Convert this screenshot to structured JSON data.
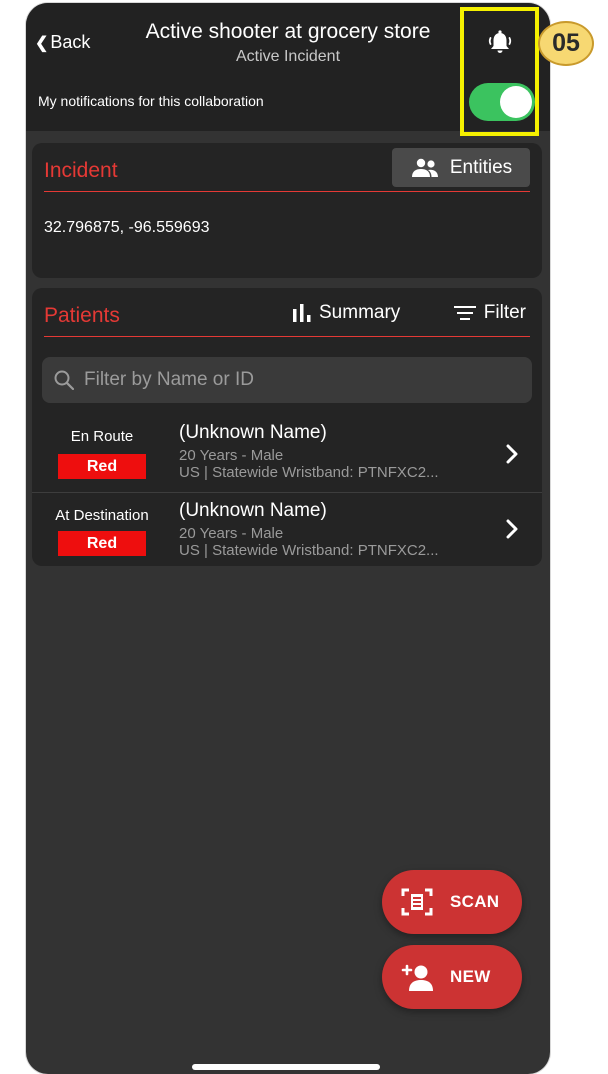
{
  "header": {
    "back_label": "Back",
    "title": "Active shooter at grocery store",
    "subtitle": "Active Incident",
    "notifications_label": "My notifications for this collaboration",
    "notifications_enabled": true,
    "bell_icon": "bell-ringing-icon"
  },
  "callout": {
    "step": "05",
    "color": "#f5f000"
  },
  "incident": {
    "title": "Incident",
    "entities_label": "Entities",
    "coordinates": "32.796875, -96.559693"
  },
  "patients": {
    "title": "Patients",
    "summary_label": "Summary",
    "filter_label": "Filter",
    "search_placeholder": "Filter by Name or ID",
    "rows": [
      {
        "status": "En Route",
        "triage": "Red",
        "name": "(Unknown Name)",
        "demographics": "20 Years - Male",
        "identifier": "US | Statewide Wristband: PTNFXC2..."
      },
      {
        "status": "At Destination",
        "triage": "Red",
        "name": "(Unknown Name)",
        "demographics": "20 Years - Male",
        "identifier": "US | Statewide Wristband: PTNFXC2..."
      }
    ]
  },
  "actions": {
    "scan_label": "SCAN",
    "new_label": "NEW"
  },
  "colors": {
    "accent_red": "#e53935",
    "triage_red": "#ee0e0e",
    "fab_red": "#cc3333",
    "toggle_on": "#3bc35f",
    "background": "#333333"
  }
}
